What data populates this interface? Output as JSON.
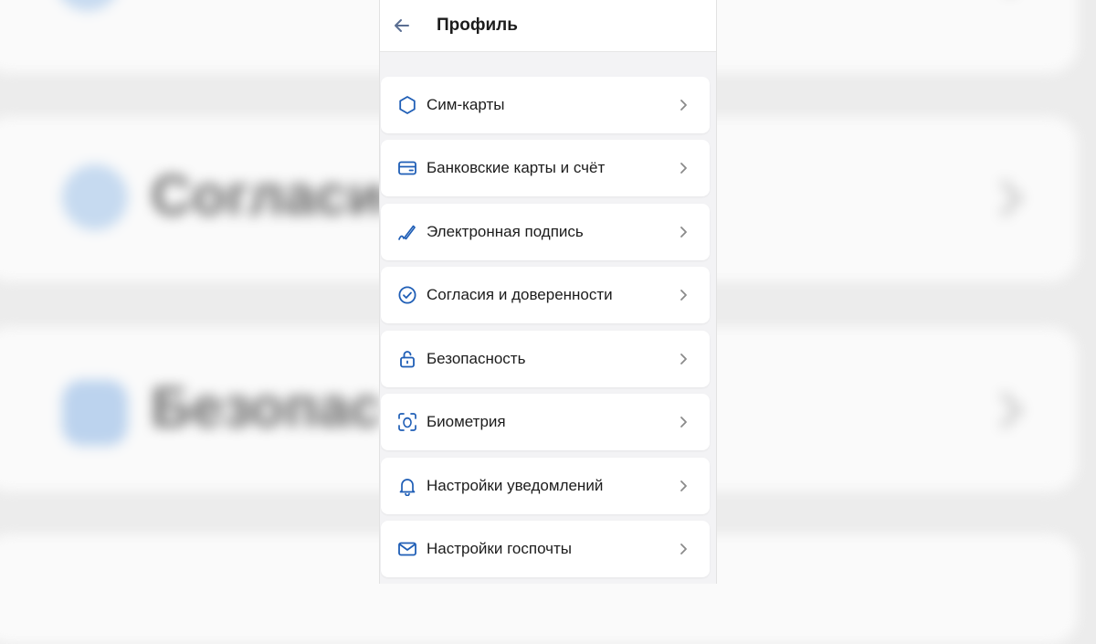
{
  "colors": {
    "accent": "#1f5eb6",
    "background": "#f3f3f5",
    "card": "#ffffff",
    "text": "#1c1c1c",
    "chevron": "#8a8a8a"
  },
  "background": {
    "blurred_texts": [
      "Согласие",
      "Безопас"
    ]
  },
  "header": {
    "title": "Профиль",
    "back_icon": "arrow-left-icon"
  },
  "menu": {
    "items": [
      {
        "label": "Сим-карты",
        "icon": "hexagon-icon"
      },
      {
        "label": "Банковские карты и счёт",
        "icon": "bank-card-icon"
      },
      {
        "label": "Электронная подпись",
        "icon": "pen-signature-icon"
      },
      {
        "label": "Согласия и доверенности",
        "icon": "check-circle-icon"
      },
      {
        "label": "Безопасность",
        "icon": "lock-icon"
      },
      {
        "label": "Биометрия",
        "icon": "face-scan-icon"
      },
      {
        "label": "Настройки уведомлений",
        "icon": "bell-icon"
      },
      {
        "label": "Настройки госпочты",
        "icon": "mail-icon"
      }
    ]
  }
}
